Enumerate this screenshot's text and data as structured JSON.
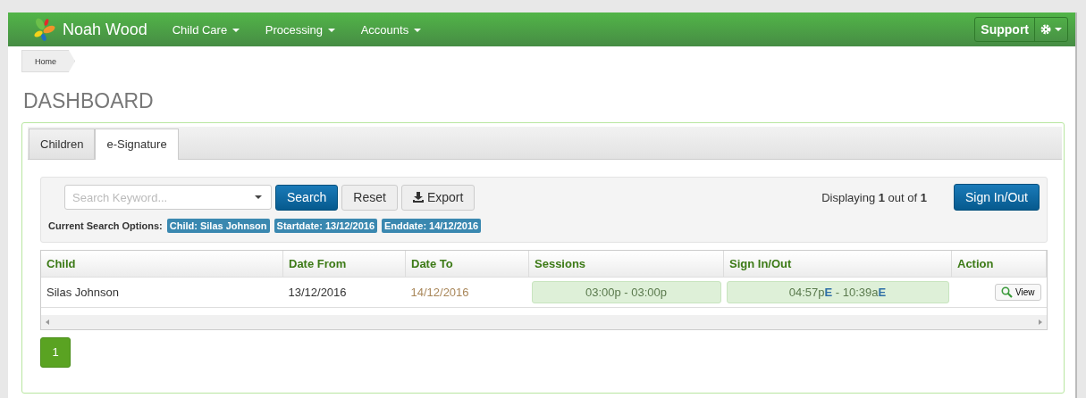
{
  "navbar": {
    "brand": "Noah Wood",
    "menus": [
      {
        "label": "Child Care"
      },
      {
        "label": "Processing"
      },
      {
        "label": "Accounts"
      }
    ],
    "support": "Support"
  },
  "breadcrumb": [
    "Home"
  ],
  "page_title": "DASHBOARD",
  "tabs": [
    {
      "label": "Children",
      "selected": false
    },
    {
      "label": "e-Signature",
      "selected": true
    }
  ],
  "search": {
    "placeholder": "Search Keyword...",
    "buttons": [
      {
        "label": "Search",
        "kind": "primary"
      },
      {
        "label": "Reset",
        "kind": "plain"
      },
      {
        "label": "Export",
        "kind": "export"
      }
    ],
    "options_label": "Current Search Options:",
    "options": [
      "Child: Silas Johnson",
      "Startdate: 13/12/2016",
      "Enddate: 14/12/2016"
    ],
    "displaying": "Displaying **1** out of **1**",
    "sign_button": "Sign In/Out"
  },
  "table": {
    "columns": [
      "Child",
      "Date From",
      "Date To",
      "Sessions",
      "Sign In/Out",
      "Action"
    ],
    "rows": [
      {
        "child": "Silas Johnson",
        "date_from": "13/12/2016",
        "date_to": "14/12/2016",
        "sessions": "03:00p - 03:00p",
        "sign": "04:57p**E** - 10:39a**E**",
        "action": "View"
      }
    ]
  },
  "pagination": [
    {
      "label": "1",
      "selected": true
    }
  ]
}
